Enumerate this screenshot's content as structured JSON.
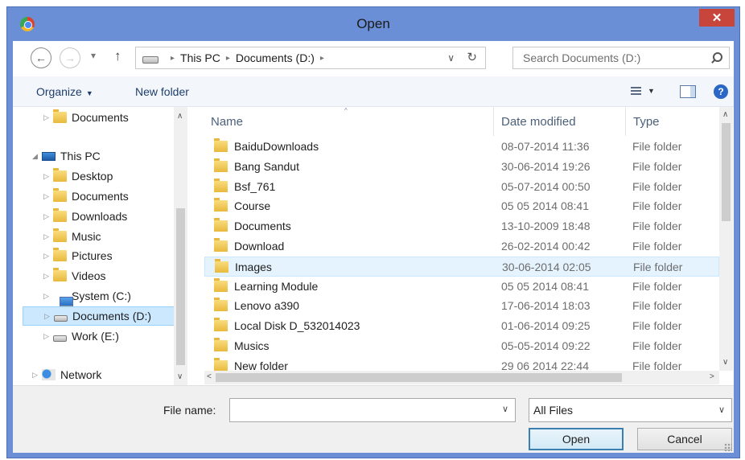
{
  "window": {
    "title": "Open",
    "close_glyph": "✕",
    "app_icon": "chrome-icon"
  },
  "nav": {
    "back_glyph": "←",
    "forward_glyph": "→",
    "recent_glyph": "▾",
    "up_glyph": "↑",
    "breadcrumb": [
      "This PC",
      "Documents (D:)"
    ],
    "crumb_sep": "▸",
    "address_dropdown_glyph": "∨",
    "refresh_glyph": "↻",
    "search_placeholder": "Search Documents (D:)"
  },
  "toolbar": {
    "organize_label": "Organize",
    "caret": "▼",
    "new_folder_label": "New folder",
    "help_glyph": "?"
  },
  "tree": [
    {
      "label": "Documents",
      "icon": "folder-icon",
      "expander": "▷",
      "indent": 1
    },
    {
      "label": "This PC",
      "icon": "computer-icon",
      "expander": "◢",
      "indent": 0
    },
    {
      "label": "Desktop",
      "icon": "desktop-folder-icon",
      "expander": "▷",
      "indent": 1
    },
    {
      "label": "Documents",
      "icon": "documents-folder-icon",
      "expander": "▷",
      "indent": 1
    },
    {
      "label": "Downloads",
      "icon": "downloads-folder-icon",
      "expander": "▷",
      "indent": 1
    },
    {
      "label": "Music",
      "icon": "music-folder-icon",
      "expander": "▷",
      "indent": 1
    },
    {
      "label": "Pictures",
      "icon": "pictures-folder-icon",
      "expander": "▷",
      "indent": 1
    },
    {
      "label": "Videos",
      "icon": "videos-folder-icon",
      "expander": "▷",
      "indent": 1
    },
    {
      "label": "System (C:)",
      "icon": "system-drive-icon",
      "expander": "▷",
      "indent": 1
    },
    {
      "label": "Documents (D:)",
      "icon": "drive-icon",
      "expander": "▷",
      "indent": 1,
      "selected": true
    },
    {
      "label": "Work (E:)",
      "icon": "drive-icon",
      "expander": "▷",
      "indent": 1
    },
    {
      "label": "Network",
      "icon": "network-icon",
      "expander": "▷",
      "indent": 0
    }
  ],
  "columns": {
    "name": "Name",
    "date": "Date modified",
    "type": "Type",
    "sort_glyph": "^"
  },
  "files": [
    {
      "name": "BaiduDownloads",
      "date": "08-07-2014 11:36",
      "type": "File folder"
    },
    {
      "name": "Bang Sandut",
      "date": "30-06-2014 19:26",
      "type": "File folder"
    },
    {
      "name": "Bsf_761",
      "date": "05-07-2014 00:50",
      "type": "File folder"
    },
    {
      "name": "Course",
      "date": "05 05 2014 08:41",
      "type": "File folder"
    },
    {
      "name": "Documents",
      "date": "13-10-2009 18:48",
      "type": "File folder"
    },
    {
      "name": "Download",
      "date": "26-02-2014 00:42",
      "type": "File folder"
    },
    {
      "name": "Images",
      "date": "30-06-2014 02:05",
      "type": "File folder",
      "selected": true
    },
    {
      "name": "Learning Module",
      "date": "05 05 2014 08:41",
      "type": "File folder"
    },
    {
      "name": "Lenovo a390",
      "date": "17-06-2014 18:03",
      "type": "File folder"
    },
    {
      "name": "Local Disk D_532014023",
      "date": "01-06-2014 09:25",
      "type": "File folder"
    },
    {
      "name": "Musics",
      "date": "05-05-2014 09:22",
      "type": "File folder"
    },
    {
      "name": "New folder",
      "date": "29 06 2014 22:44",
      "type": "File folder"
    }
  ],
  "scroll": {
    "up": "∧",
    "down": "∨",
    "left": "<",
    "right": ">"
  },
  "footer": {
    "file_name_label": "File name:",
    "file_name_value": "",
    "dropdown_glyph": "∨",
    "file_type_value": "All Files",
    "open_label": "Open",
    "cancel_label": "Cancel"
  }
}
